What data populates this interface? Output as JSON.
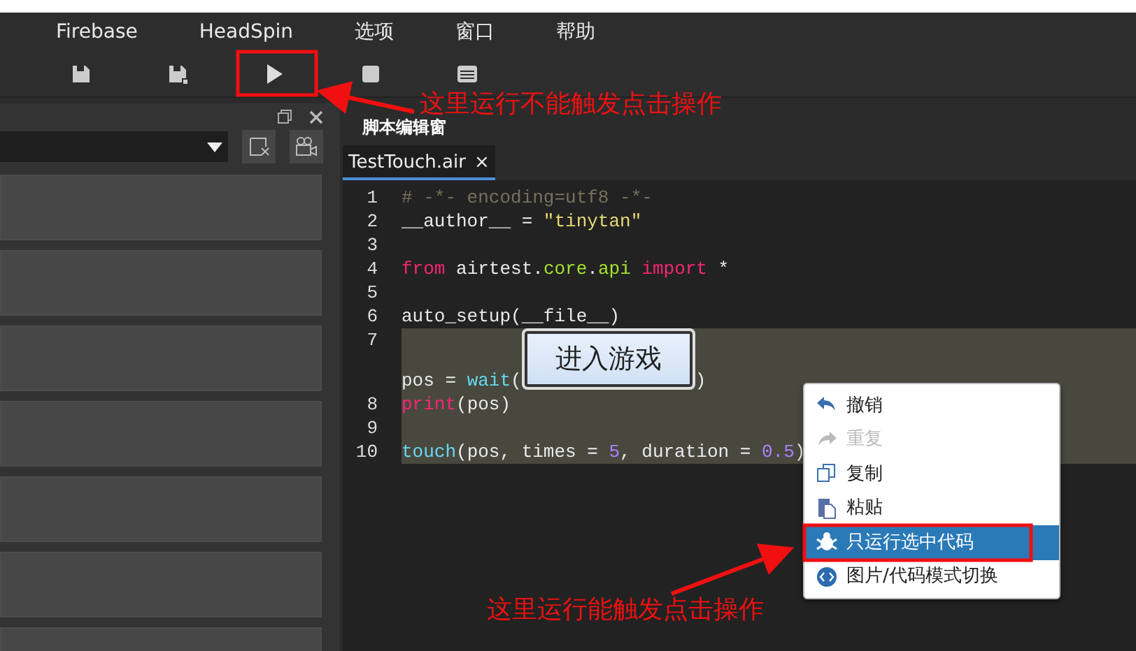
{
  "menu_bar": [
    {
      "label": "Firebase"
    },
    {
      "label": "HeadSpin"
    },
    {
      "label": "选项"
    },
    {
      "label": "窗口"
    },
    {
      "label": "帮助"
    }
  ],
  "toolbar": [
    {
      "kind": "save"
    },
    {
      "kind": "save-as"
    },
    {
      "kind": "run"
    },
    {
      "kind": "stop"
    },
    {
      "kind": "log"
    }
  ],
  "editor": {
    "title": "脚本编辑窗",
    "tabs": [
      {
        "label": "TestTouch.air",
        "close": "×",
        "selected": true
      }
    ],
    "lines": [
      {
        "number": "1",
        "selected": false,
        "tokens": [
          {
            "kind": "comment",
            "text": "# -*- encoding=utf8 -*-"
          }
        ]
      },
      {
        "number": "2",
        "selected": false,
        "tokens": [
          {
            "kind": "plain",
            "text": "__author__ = "
          },
          {
            "kind": "string",
            "text": "\"tinytan\""
          }
        ]
      },
      {
        "number": "3",
        "selected": false
      },
      {
        "number": "4",
        "selected": false,
        "tokens": [
          {
            "kind": "keyword",
            "text": "from"
          },
          {
            "kind": "plain",
            "text": " airtest."
          },
          {
            "kind": "module",
            "text": "core"
          },
          {
            "kind": "plain",
            "text": "."
          },
          {
            "kind": "module",
            "text": "api"
          },
          {
            "kind": "keyword",
            "text": " import"
          },
          {
            "kind": "plain",
            "text": " *"
          }
        ]
      },
      {
        "number": "5",
        "selected": false
      },
      {
        "number": "6",
        "selected": false,
        "tokens": [
          {
            "kind": "plain",
            "text": "auto_setup(__file__)"
          }
        ]
      },
      {
        "number": "7",
        "selected": true,
        "tokens": [
          {
            "kind": "plain",
            "text": "pos = "
          },
          {
            "kind": "builtin",
            "text": "wait"
          },
          {
            "kind": "plain",
            "text": "("
          },
          {
            "kind": "image",
            "text": "进入游戏"
          },
          {
            "kind": "plain",
            "text": ")"
          }
        ]
      },
      {
        "number": "8",
        "selected": true,
        "tokens": [
          {
            "kind": "keyword",
            "text": "print"
          },
          {
            "kind": "plain",
            "text": "(pos)"
          }
        ]
      },
      {
        "number": "9",
        "selected": true
      },
      {
        "number": "10",
        "selected": true,
        "tokens": [
          {
            "kind": "builtin",
            "text": "touch"
          },
          {
            "kind": "plain",
            "text": "(pos, times = "
          },
          {
            "kind": "number",
            "text": "5"
          },
          {
            "kind": "plain",
            "text": ", duration = "
          },
          {
            "kind": "number",
            "text": "0.5"
          },
          {
            "kind": "plain",
            "text": ")"
          }
        ]
      }
    ]
  },
  "context_menu": [
    {
      "kind": "undo",
      "label": "撤销",
      "disabled": false,
      "selected": false
    },
    {
      "kind": "redo",
      "label": "重复",
      "disabled": true,
      "selected": false
    },
    {
      "kind": "copy",
      "label": "复制",
      "disabled": false,
      "selected": false
    },
    {
      "kind": "paste",
      "label": "粘贴",
      "disabled": false,
      "selected": false
    },
    {
      "kind": "run",
      "label": "只运行选中代码",
      "disabled": false,
      "selected": true
    },
    {
      "kind": "toggle",
      "label": "图片/代码模式切换",
      "disabled": false,
      "selected": false
    }
  ],
  "annotations": [
    {
      "text": "这里运行不能触发点击操作"
    },
    {
      "text": "这里运行能触发点击操作"
    }
  ]
}
